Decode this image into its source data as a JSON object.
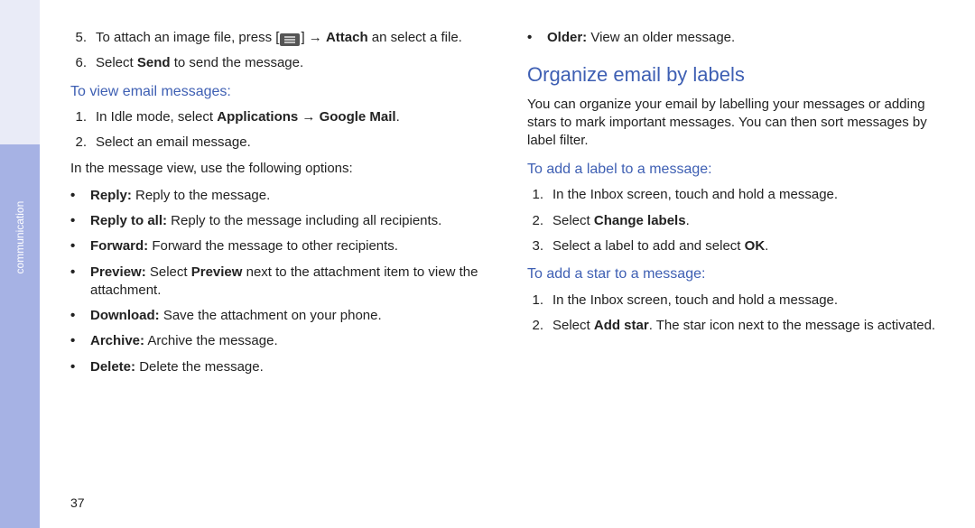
{
  "sideTab": "communication",
  "pageNumber": "37",
  "left": {
    "contSteps": [
      {
        "n": "5.",
        "pre": "To attach an image file, press [",
        "icon": "menu-icon",
        "mid": "] → ",
        "bold": "Attach",
        "post": " an select a file."
      },
      {
        "n": "6.",
        "pre": "Select ",
        "bold": "Send",
        "post": " to send the message."
      }
    ],
    "sub1": "To view email messages:",
    "steps2": [
      {
        "n": "1.",
        "pre": "In Idle mode, select ",
        "bold": "Applications → Google Mail",
        "post": "."
      },
      {
        "n": "2.",
        "pre": "Select an email message.",
        "bold": "",
        "post": ""
      }
    ],
    "afterSteps2": "In the message view, use the following options:",
    "bullets": [
      {
        "bold": "Reply:",
        "text": " Reply to the message."
      },
      {
        "bold": "Reply to all:",
        "text": " Reply to the message including all recipients."
      },
      {
        "bold": "Forward:",
        "text": " Forward the message to other recipients."
      },
      {
        "bold": "Preview:",
        "boldExtra": "Preview",
        "pre": " Select ",
        "post": " next to the attachment item to view the attachment."
      },
      {
        "bold": "Download:",
        "text": " Save the attachment on your phone."
      },
      {
        "bold": "Archive:",
        "text": " Archive the message."
      },
      {
        "bold": "Delete:",
        "text": " Delete the message."
      }
    ]
  },
  "right": {
    "topBullet": {
      "bold": "Older:",
      "text": " View an older message."
    },
    "h2": "Organize email by labels",
    "intro": "You can organize your email by labelling your messages or adding stars to mark important messages. You can then sort messages by label filter.",
    "subA": "To add a label to a message:",
    "stepsA": [
      {
        "n": "1.",
        "pre": "In the Inbox screen, touch and hold a message.",
        "bold": "",
        "post": ""
      },
      {
        "n": "2.",
        "pre": "Select ",
        "bold": "Change labels",
        "post": "."
      },
      {
        "n": "3.",
        "pre": "Select a label to add and select ",
        "bold": "OK",
        "post": "."
      }
    ],
    "subB": "To add a star to a message:",
    "stepsB": [
      {
        "n": "1.",
        "pre": "In the Inbox screen, touch and hold a message.",
        "bold": "",
        "post": ""
      },
      {
        "n": "2.",
        "pre": "Select ",
        "bold": "Add star",
        "post": ". The star icon next to the message is activated."
      }
    ]
  }
}
